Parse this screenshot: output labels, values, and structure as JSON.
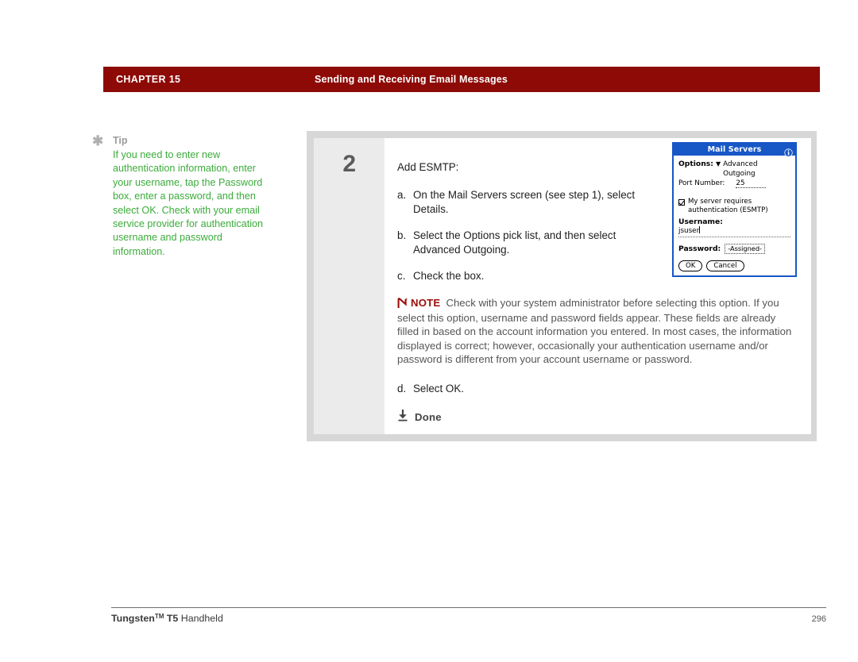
{
  "header": {
    "chapter": "CHAPTER 15",
    "title": "Sending and Receiving Email Messages",
    "bar_color": "#8d0a07"
  },
  "tip": {
    "icon": "asterisk-icon",
    "label": "Tip",
    "text": "If you need to enter new authentication information, enter your username, tap the Password box, enter a password, and then select OK. Check with your email service provider for authentication username and password information.",
    "text_color": "#3bac3b"
  },
  "step": {
    "number": "2",
    "intro": "Add ESMTP:",
    "substeps": [
      {
        "marker": "a.",
        "text": "On the Mail Servers screen (see step 1), select Details."
      },
      {
        "marker": "b.",
        "text": "Select the Options pick list, and then select Advanced Outgoing."
      },
      {
        "marker": "c.",
        "text": "Check the box."
      }
    ],
    "note": {
      "icon": "note-n-icon",
      "word": "NOTE",
      "text": "Check with your system administrator before selecting this option. If you select this option, username and password fields appear. These fields are already filled in based on the account information you entered. In most cases, the information displayed is correct; however, occasionally your authentication username and/or password is different from your account username or password.",
      "word_color": "#9c0d0a"
    },
    "substep_d": {
      "marker": "d.",
      "text": "Select OK."
    },
    "done": {
      "icon": "down-arrow-done-icon",
      "label": "Done"
    }
  },
  "dialog": {
    "title": "Mail Servers",
    "info_icon": "info-circle-icon",
    "border_color": "#1757c6",
    "options_label": "Options:",
    "options_value": "Advanced Outgoing",
    "port_label": "Port Number:",
    "port_value": "25",
    "checkbox_checked": true,
    "checkbox_line1": "My server requires",
    "checkbox_line2": "authentication (ESMTP)",
    "username_label": "Username:",
    "username_value": "jsuser",
    "password_label": "Password:",
    "password_value": "-Assigned-",
    "ok_button": "OK",
    "cancel_button": "Cancel"
  },
  "footer": {
    "product": "Tungsten",
    "tm": "TM",
    "model": "T5",
    "kind": "Handheld",
    "page": "296"
  }
}
